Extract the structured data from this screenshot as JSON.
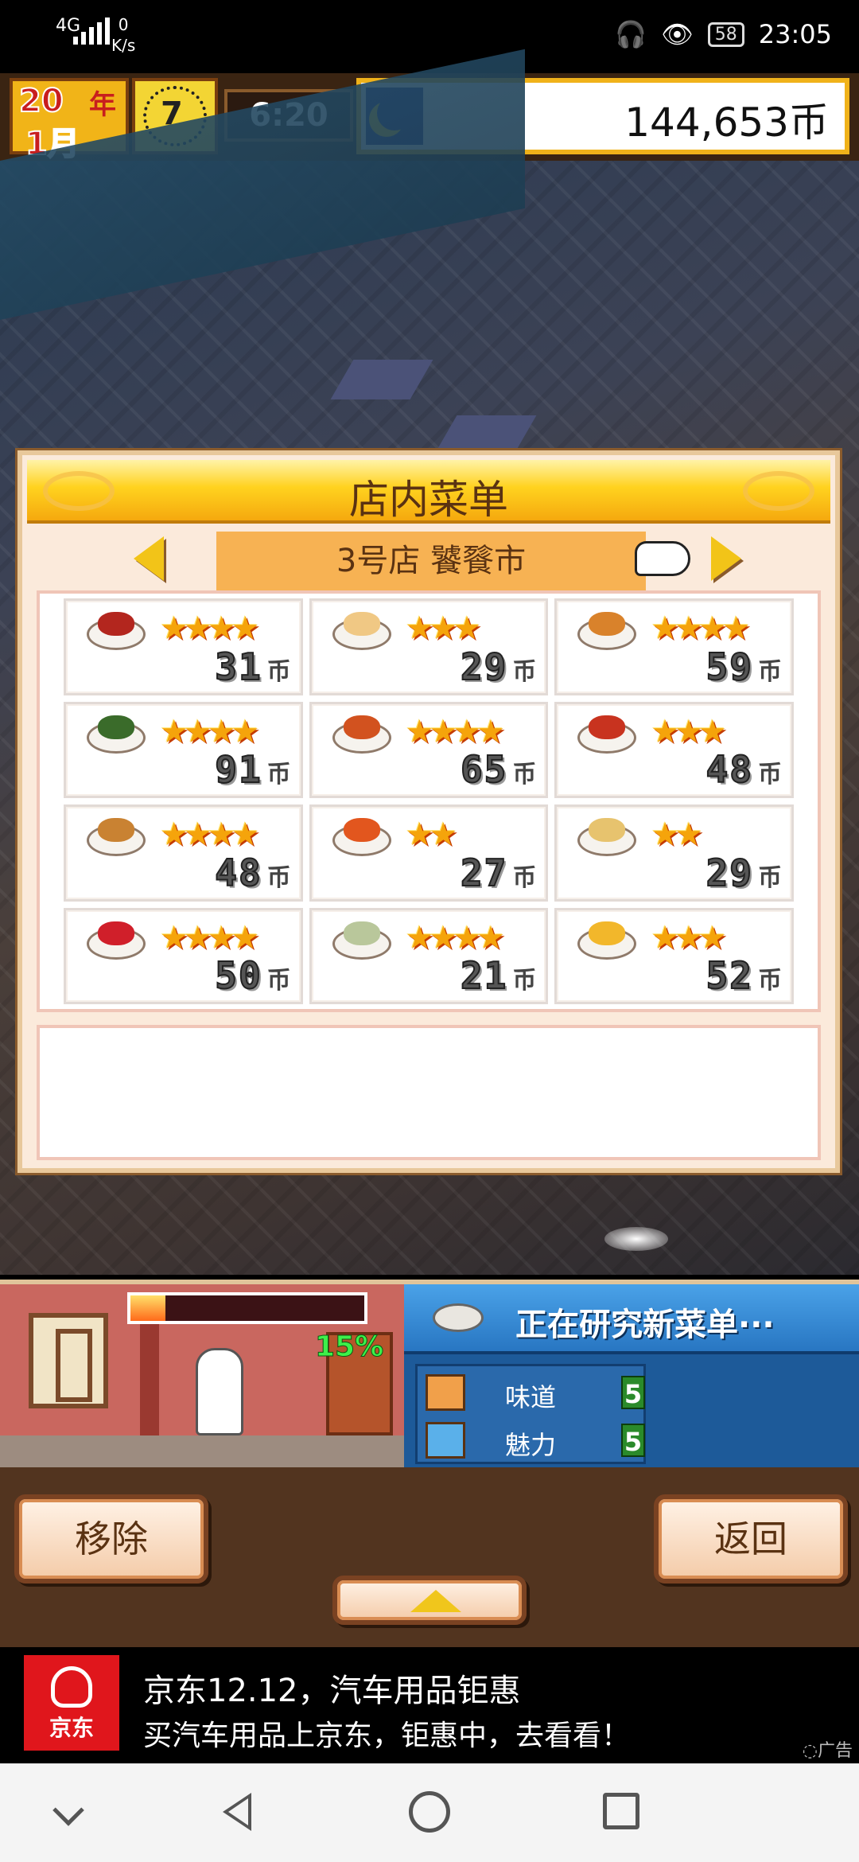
{
  "status_bar": {
    "network": "4G",
    "speed_value": "0",
    "speed_unit": "K/s",
    "battery": "58",
    "time": "23:05"
  },
  "hud": {
    "year_num": "20",
    "year_char": "年",
    "month": "1月",
    "clock_num": "7",
    "time": "6:20",
    "weather_icon": "moon-icon",
    "coins": "144,653币"
  },
  "menu": {
    "title": "店内菜单",
    "shop_name": "3号店 饕餮市",
    "dishes": [
      {
        "stars": "★★★★",
        "price": "31",
        "unit": "币",
        "color": "#b3261e"
      },
      {
        "stars": "★★★",
        "price": "29",
        "unit": "币",
        "color": "#f0c884"
      },
      {
        "stars": "★★★★",
        "price": "59",
        "unit": "币",
        "color": "#d9822b"
      },
      {
        "stars": "★★★★",
        "price": "91",
        "unit": "币",
        "color": "#3a6b2a"
      },
      {
        "stars": "★★★★",
        "price": "65",
        "unit": "币",
        "color": "#d2521f"
      },
      {
        "stars": "★★★",
        "price": "48",
        "unit": "币",
        "color": "#c8331f"
      },
      {
        "stars": "★★★★",
        "price": "48",
        "unit": "币",
        "color": "#c98232"
      },
      {
        "stars": "★★",
        "price": "27",
        "unit": "币",
        "color": "#e2561e"
      },
      {
        "stars": "★★",
        "price": "29",
        "unit": "币",
        "color": "#e7c36e"
      },
      {
        "stars": "★★★★",
        "price": "50",
        "unit": "币",
        "color": "#d01f2a"
      },
      {
        "stars": "★★★★",
        "price": "21",
        "unit": "币",
        "color": "#b9c79b"
      },
      {
        "stars": "★★★",
        "price": "52",
        "unit": "币",
        "color": "#f2b72b"
      }
    ],
    "description": ""
  },
  "kitchen": {
    "progress_fraction": 0.15,
    "progress_label": "15%"
  },
  "research": {
    "header": "正在研究新菜单···",
    "stats": [
      {
        "label": "味道",
        "value": "5",
        "icon": "taste-icon"
      },
      {
        "label": "魅力",
        "value": "5",
        "icon": "charm-icon"
      }
    ]
  },
  "actions": {
    "remove": "移除",
    "back": "返回"
  },
  "ad": {
    "logo_text": "京东",
    "line1": "京东12.12，汽车用品钜惠",
    "line2": "买汽车用品上京东，钜惠中，去看看！",
    "tag": "◌广告"
  }
}
